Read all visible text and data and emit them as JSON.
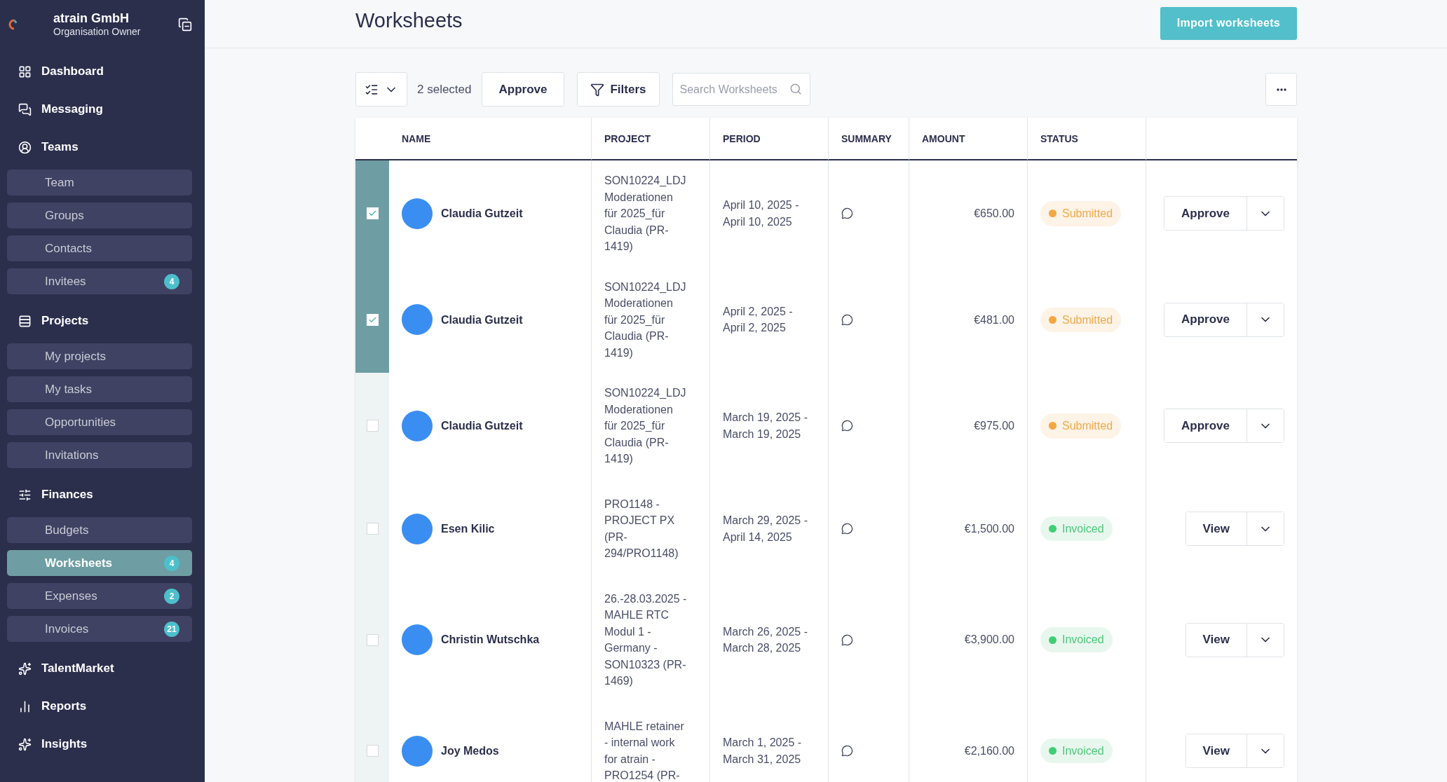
{
  "sidebar": {
    "org_name": "atrain GmbH",
    "org_role": "Organisation Owner",
    "nav": [
      {
        "label": "Dashboard"
      },
      {
        "label": "Messaging"
      },
      {
        "label": "Teams",
        "children": [
          {
            "label": "Team",
            "selected": false
          },
          {
            "label": "Groups",
            "selected": false
          },
          {
            "label": "Contacts",
            "selected": false
          },
          {
            "label": "Invitees",
            "selected": false,
            "badge": "4"
          }
        ]
      },
      {
        "label": "Projects",
        "children": [
          {
            "label": "My projects",
            "selected": false
          },
          {
            "label": "My tasks",
            "selected": false
          },
          {
            "label": "Opportunities",
            "selected": false
          },
          {
            "label": "Invitations",
            "selected": false
          }
        ]
      },
      {
        "label": "Finances",
        "children": [
          {
            "label": "Budgets",
            "selected": false
          },
          {
            "label": "Worksheets",
            "selected": true,
            "badge": "4"
          },
          {
            "label": "Expenses",
            "selected": false,
            "badge": "2"
          },
          {
            "label": "Invoices",
            "selected": false,
            "badge": "21"
          }
        ]
      },
      {
        "label": "TalentMarket"
      },
      {
        "label": "Reports"
      },
      {
        "label": "Insights"
      }
    ]
  },
  "page": {
    "title": "Worksheets",
    "import_button": "Import worksheets"
  },
  "toolbar": {
    "selection_count": "2 selected",
    "approve_button": "Approve",
    "filters_button": "Filters",
    "search": {
      "placeholder": "Search Worksheets"
    }
  },
  "table": {
    "columns": [
      "NAME",
      "PROJECT",
      "PERIOD",
      "SUMMARY",
      "AMOUNT",
      "STATUS"
    ],
    "rows": [
      {
        "selected": true,
        "name": "Claudia Gutzeit",
        "project": "SON10224_LDJ Moderationen für 2025_für Claudia (PR-1419)",
        "period": "April 10, 2025 - April 10, 2025",
        "amount": "€650.00",
        "status": {
          "label": "Submitted",
          "kind": "submitted"
        },
        "action": "Approve"
      },
      {
        "selected": true,
        "name": "Claudia Gutzeit",
        "project": "SON10224_LDJ Moderationen für 2025_für Claudia (PR-1419)",
        "period": "April 2, 2025 - April 2, 2025",
        "amount": "€481.00",
        "status": {
          "label": "Submitted",
          "kind": "submitted"
        },
        "action": "Approve"
      },
      {
        "selected": false,
        "name": "Claudia Gutzeit",
        "project": "SON10224_LDJ Moderationen für 2025_für Claudia (PR-1419)",
        "period": "March 19, 2025 - March 19, 2025",
        "amount": "€975.00",
        "status": {
          "label": "Submitted",
          "kind": "submitted"
        },
        "action": "Approve"
      },
      {
        "selected": false,
        "name": "Esen Kilic",
        "project": "PRO1148 - PROJECT PX (PR-294/PRO1148)",
        "period": "March 29, 2025 - April 14, 2025",
        "amount": "€1,500.00",
        "status": {
          "label": "Invoiced",
          "kind": "invoiced"
        },
        "action": "View"
      },
      {
        "selected": false,
        "name": "Christin Wutschka",
        "project": "26.-28.03.2025 - MAHLE RTC Modul 1 - Germany - SON10323 (PR-1469)",
        "period": "March 26, 2025 - March 28, 2025",
        "amount": "€3,900.00",
        "status": {
          "label": "Invoiced",
          "kind": "invoiced"
        },
        "action": "View"
      },
      {
        "selected": false,
        "name": "Joy Medos",
        "project": "MAHLE retainer - internal work for atrain - PRO1254 (PR-",
        "period": "March 1, 2025 - March 31, 2025",
        "amount": "€2,160.00",
        "status": {
          "label": "Invoiced",
          "kind": "invoiced"
        },
        "action": "View"
      }
    ]
  }
}
